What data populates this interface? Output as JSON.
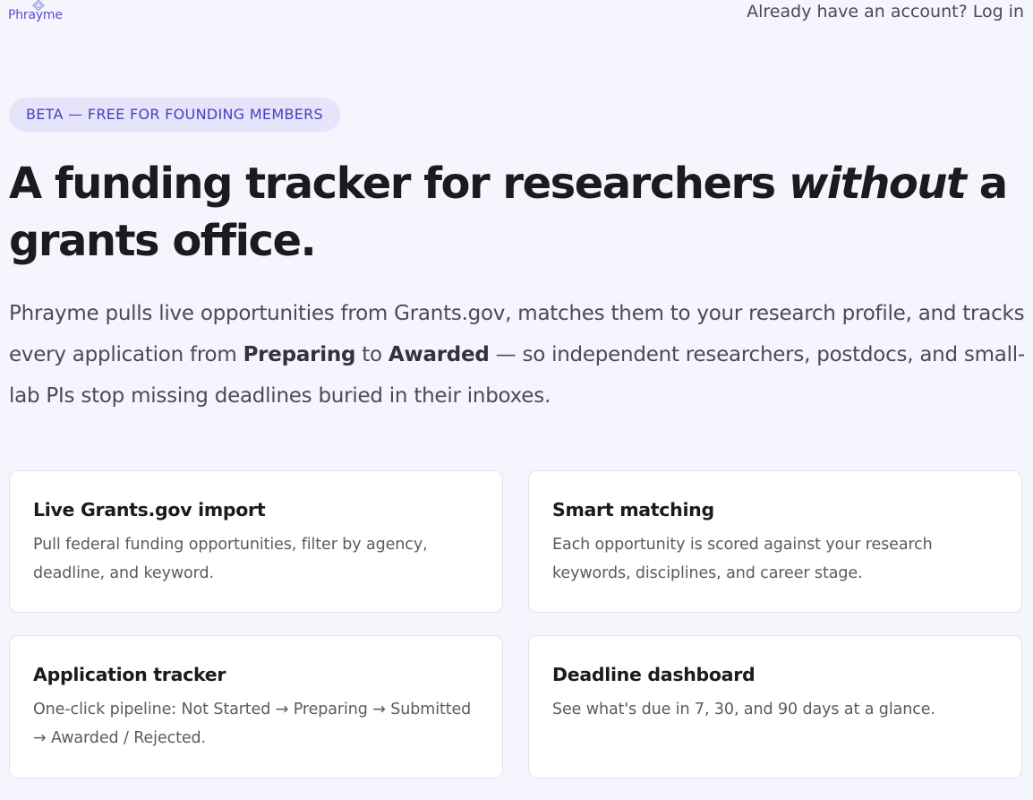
{
  "header": {
    "logo_text": "Phrayme",
    "login_link": "Already have an account? Log in"
  },
  "hero": {
    "badge": "BETA — FREE FOR FOUNDING MEMBERS",
    "headline": {
      "part1": "A funding tracker for researchers ",
      "emphasis": "without",
      "part2": " a grants office."
    },
    "intro": {
      "part1": "Phrayme pulls live opportunities from Grants.gov, matches them to your research profile, and tracks every application from ",
      "bold1": "Preparing",
      "part2": " to ",
      "bold2": "Awarded",
      "part3": " — so independent researchers, postdocs, and small-lab PIs stop missing deadlines buried in their inboxes."
    }
  },
  "features": [
    {
      "title": "Live Grants.gov import",
      "description": "Pull federal funding opportunities, filter by agency, deadline, and keyword."
    },
    {
      "title": "Smart matching",
      "description": "Each opportunity is scored against your research keywords, disciplines, and career stage."
    },
    {
      "title": "Application tracker",
      "description": "One-click pipeline: Not Started → Preparing → Submitted → Awarded / Rejected."
    },
    {
      "title": "Deadline dashboard",
      "description": "See what's due in 7, 30, and 90 days at a glance."
    }
  ],
  "colors": {
    "page_background": "#f5f5fd",
    "accent": "#5b4fc9",
    "badge_background": "#e5e4fb",
    "badge_text": "#4a3fc0",
    "heading": "#1a1a1f",
    "body_text": "#4b4b55"
  },
  "icons": {
    "logo": "diamond-logo-icon"
  }
}
